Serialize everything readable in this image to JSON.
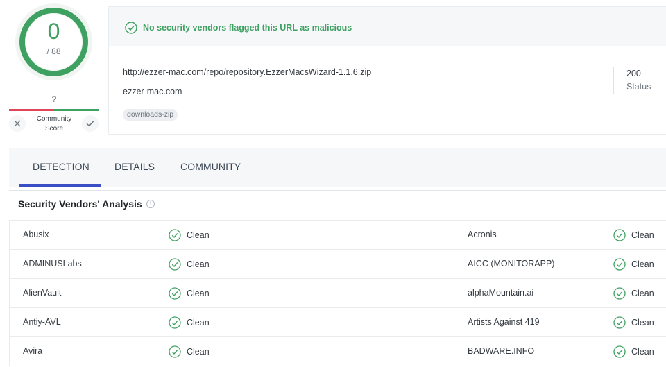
{
  "score": {
    "value": "0",
    "total": "/ 88",
    "question": "?",
    "community_label_line1": "Community",
    "community_label_line2": "Score",
    "colors": {
      "good": "#3fa161",
      "bad": "#e0465b"
    }
  },
  "summary": {
    "banner_text": "No security vendors flagged this URL as malicious",
    "url": "http://ezzer-mac.com/repo/repository.EzzerMacsWizard-1.1.6.zip",
    "domain": "ezzer-mac.com",
    "tag": "downloads-zip",
    "status_code": "200",
    "status_label": "Status"
  },
  "tabs": [
    {
      "label": "DETECTION",
      "active": true
    },
    {
      "label": "DETAILS",
      "active": false
    },
    {
      "label": "COMMUNITY",
      "active": false
    }
  ],
  "analysis": {
    "title": "Security Vendors' Analysis",
    "info_glyph": "i",
    "rows": [
      {
        "left_vendor": "Abusix",
        "left_result": "Clean",
        "right_vendor": "Acronis",
        "right_result": "Clean"
      },
      {
        "left_vendor": "ADMINUSLabs",
        "left_result": "Clean",
        "right_vendor": "AICC (MONITORAPP)",
        "right_result": "Clean"
      },
      {
        "left_vendor": "AlienVault",
        "left_result": "Clean",
        "right_vendor": "alphaMountain.ai",
        "right_result": "Clean"
      },
      {
        "left_vendor": "Antiy-AVL",
        "left_result": "Clean",
        "right_vendor": "Artists Against 419",
        "right_result": "Clean"
      },
      {
        "left_vendor": "Avira",
        "left_result": "Clean",
        "right_vendor": "BADWARE.INFO",
        "right_result": "Clean"
      }
    ]
  },
  "icons": {
    "banner": "check-circle-icon",
    "clean": "check-circle-icon",
    "dislike": "close-icon",
    "like": "checkmark-icon",
    "info": "info-icon"
  }
}
